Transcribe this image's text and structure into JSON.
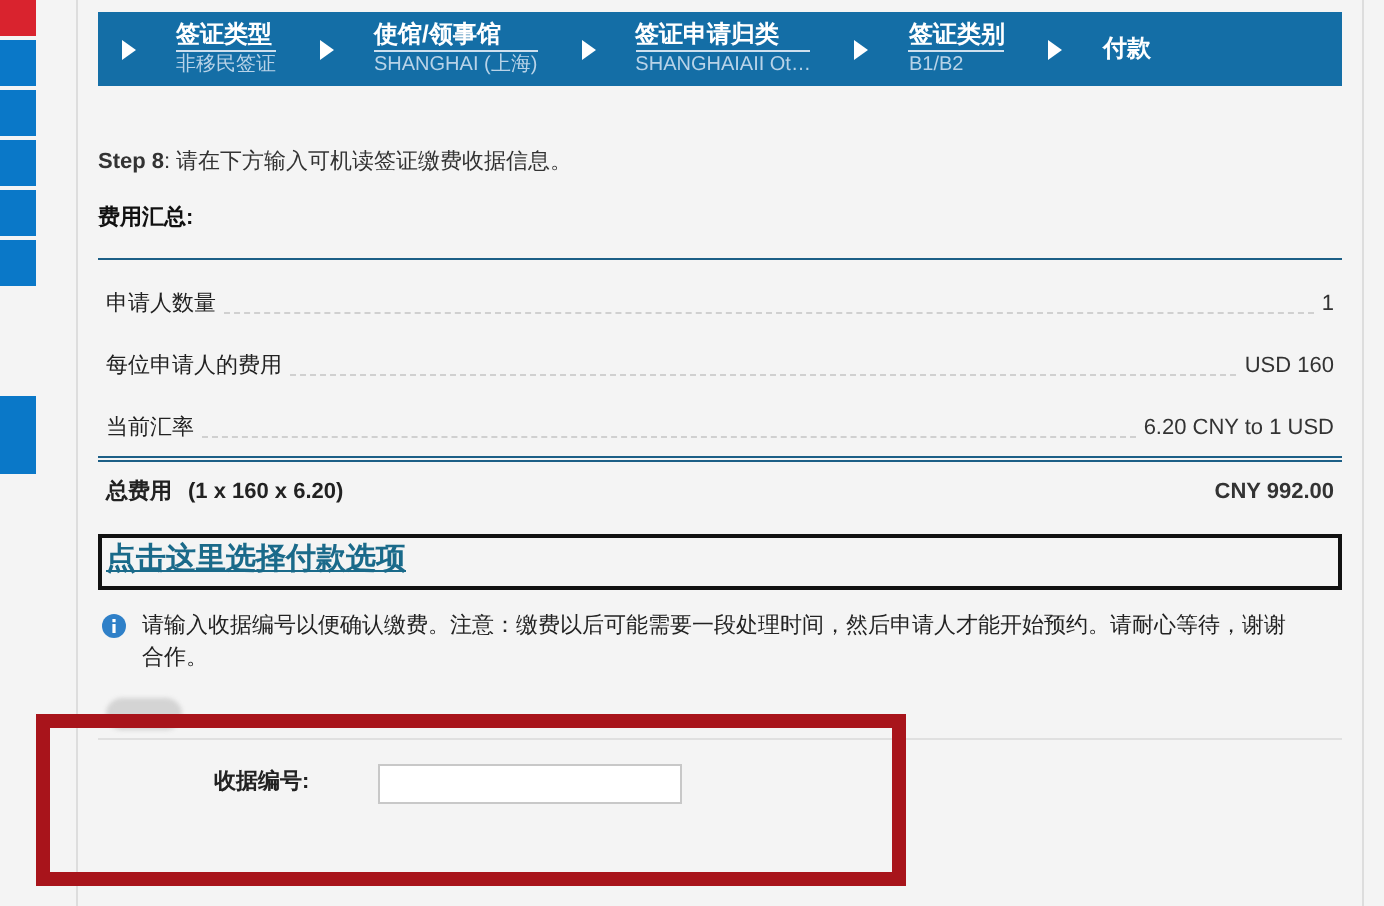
{
  "breadcrumb": [
    {
      "title": "签证类型",
      "subtitle": "非移民签证"
    },
    {
      "title": "使馆/领事馆",
      "subtitle": "SHANGHAI (上海)"
    },
    {
      "title": "签证申请归类",
      "subtitle": "SHANGHAIAII Ot…"
    },
    {
      "title": "签证类别",
      "subtitle": "B1/B2"
    },
    {
      "title": "付款"
    }
  ],
  "instruction": "**Step 8**: 请在下方输入可机读签证缴费收据信息。",
  "summary_heading": "费用汇总:",
  "fee_rows": [
    {
      "label": "申请人数量",
      "value": "1"
    },
    {
      "label": "每位申请人的费用",
      "value": "USD 160"
    },
    {
      "label": "当前汇率",
      "value": "6.20 CNY to 1 USD"
    }
  ],
  "total": {
    "label": "总费用",
    "formula": "(1 x 160 x 6.20)",
    "value": "CNY 992.00"
  },
  "payment_link": "点击这里选择付款选项",
  "notice": "请输入收据编号以便确认缴费。注意：缴费以后可能需要一段处理时间，然后申请人才能开始预约。请耐心等待，谢谢合作。",
  "receipt_field": {
    "label": "收据编号:"
  },
  "sidebar_tabs": [
    {
      "selected": true
    },
    {
      "selected": false
    },
    {
      "selected": false
    },
    {
      "selected": false
    },
    {
      "selected": false
    },
    {
      "selected": false
    },
    {
      "selected": false
    }
  ]
}
